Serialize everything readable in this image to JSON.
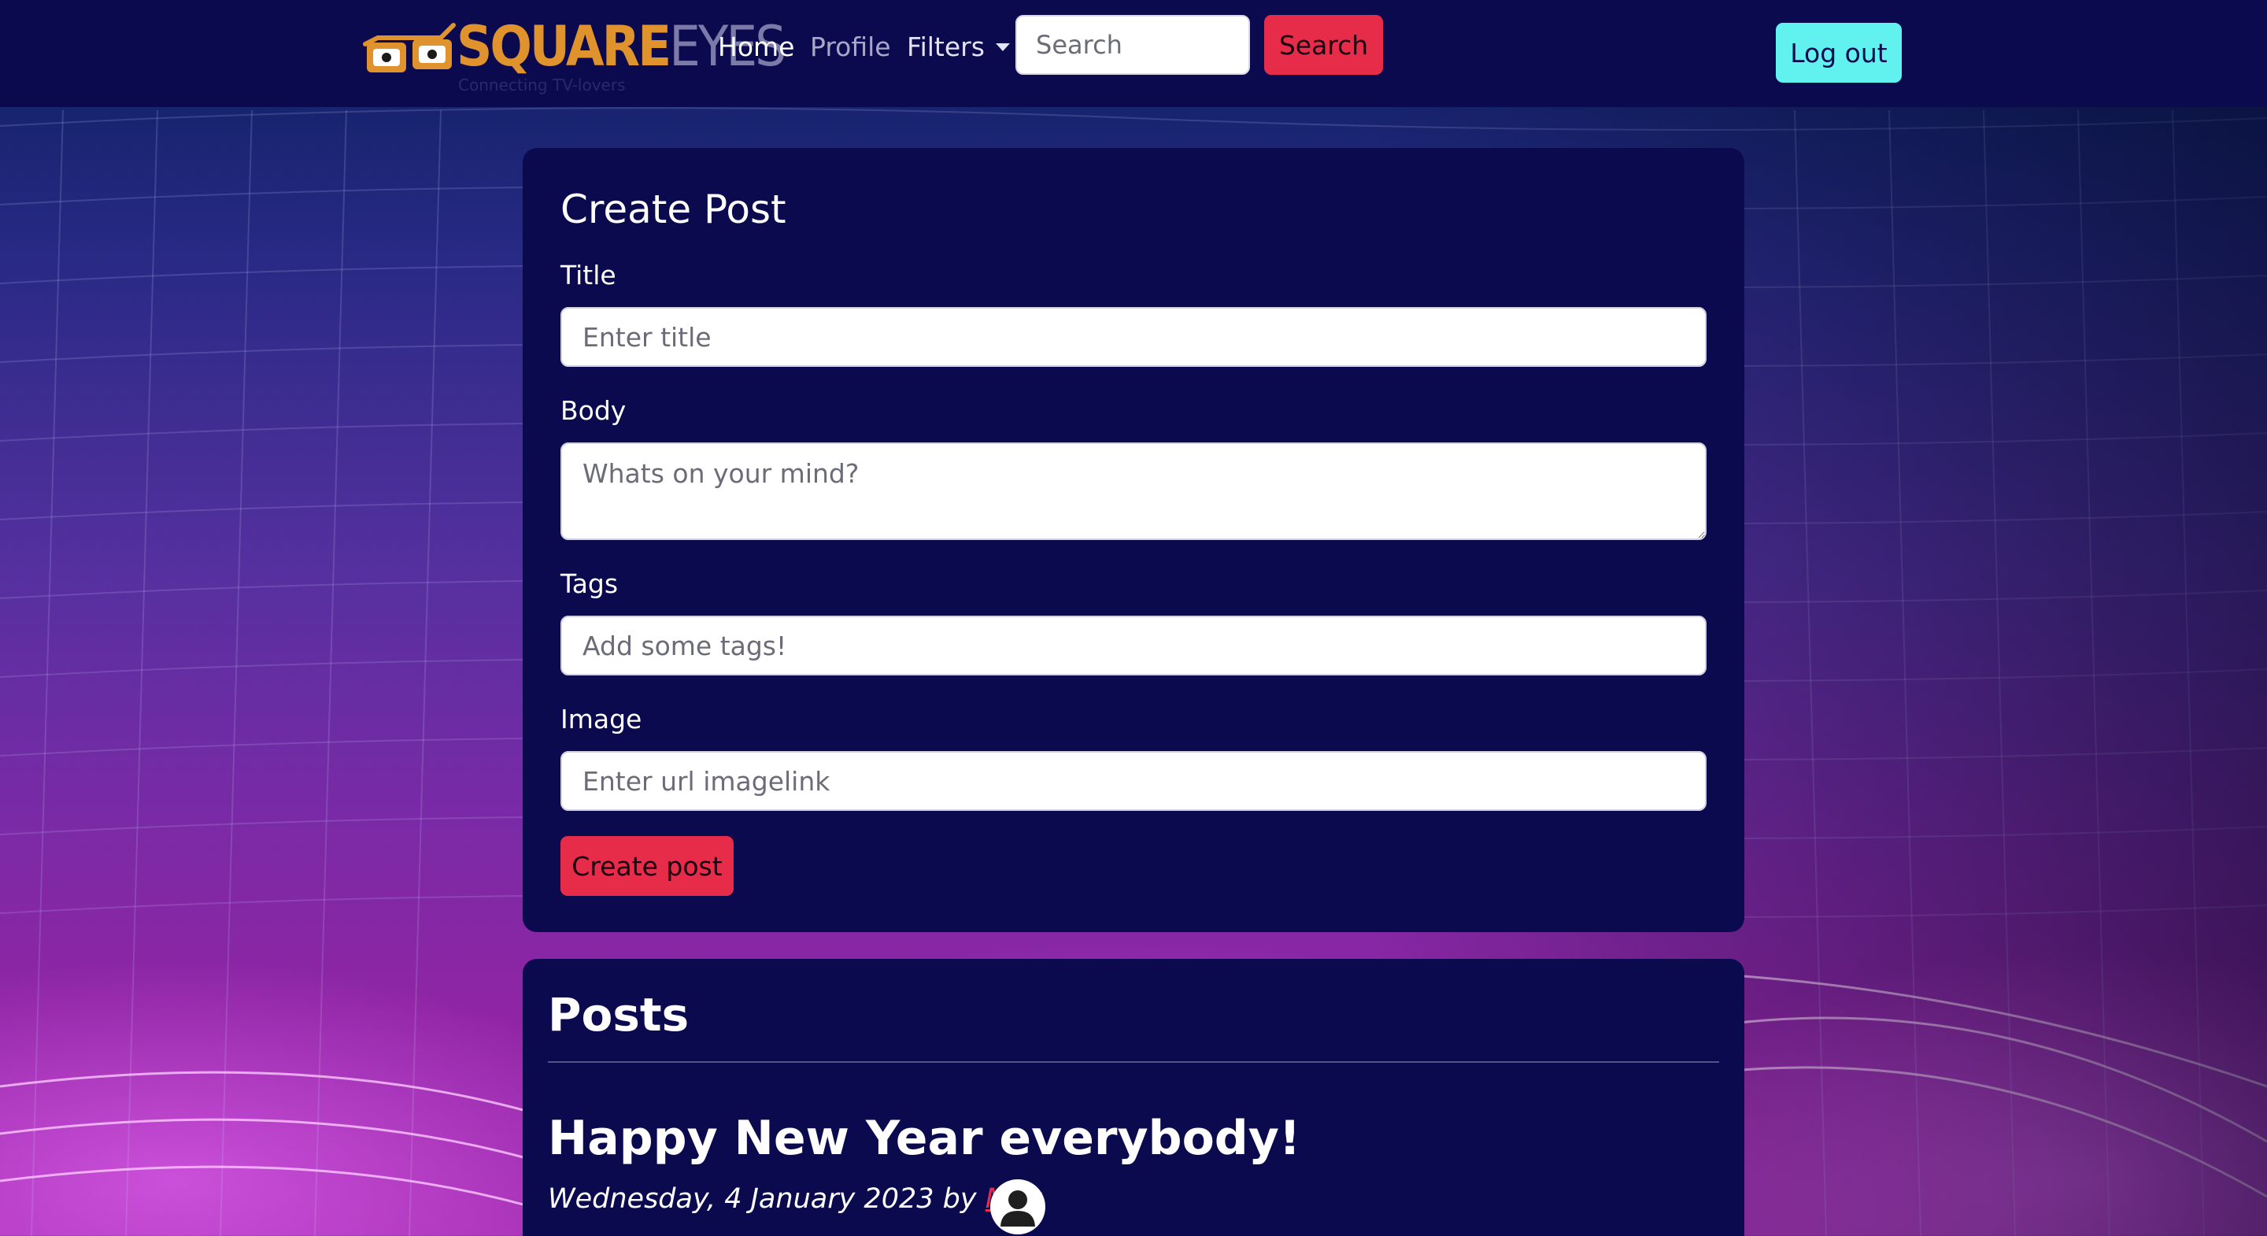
{
  "brand": {
    "square": "SQUARE",
    "eyes": "EYES",
    "tagline": "Connecting TV-lovers"
  },
  "nav": {
    "home": "Home",
    "profile": "Profile",
    "filters": "Filters",
    "search_placeholder": "Search",
    "search_button": "Search",
    "logout": "Log out"
  },
  "create_post": {
    "heading": "Create Post",
    "title_label": "Title",
    "title_placeholder": "Enter title",
    "body_label": "Body",
    "body_placeholder": "Whats on your mind?",
    "tags_label": "Tags",
    "tags_placeholder": "Add some tags!",
    "image_label": "Image",
    "image_placeholder": "Enter url imagelink",
    "submit": "Create post"
  },
  "posts": {
    "heading": "Posts",
    "items": [
      {
        "title": "Happy New Year everybody!",
        "date": "Wednesday, 4 January 2023",
        "by": "by",
        "author": "May"
      }
    ]
  },
  "colors": {
    "navbar": "#0b0a4f",
    "card": "#0b0a4f",
    "accent_red": "#e72c4a",
    "accent_cyan": "#61f2ef",
    "brand_orange": "#e0932d"
  },
  "icons": {
    "logo": "glasses-logo-icon",
    "dropdown": "caret-down-icon",
    "avatar": "user-avatar-icon"
  }
}
